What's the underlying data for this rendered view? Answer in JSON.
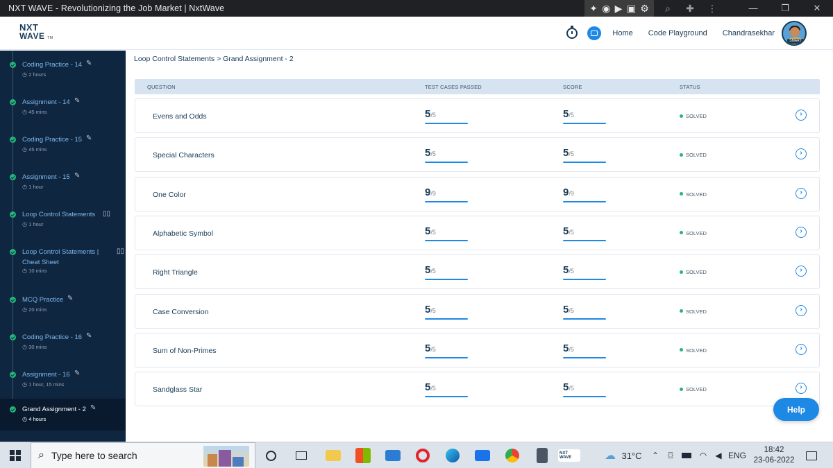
{
  "window": {
    "title": "NXT WAVE - Revolutionizing the Job Market | NxtWave"
  },
  "header": {
    "logo_line1": "NXT",
    "logo_line2": "WAVE",
    "logo_tm": "TM",
    "nav": [
      "Home",
      "Code Playground"
    ],
    "user_name": "Chandrasekhar",
    "avatar_badge": "SMART"
  },
  "sidebar": {
    "items": [
      {
        "name": "Coding Practice - 14",
        "duration": "2 hours",
        "icon": "pencil-icon"
      },
      {
        "name": "Assignment - 14",
        "duration": "45 mins",
        "icon": "pencil-icon"
      },
      {
        "name": "Coding Practice - 15",
        "duration": "45 mins",
        "icon": "pencil-icon"
      },
      {
        "name": "Assignment - 15",
        "duration": "1 hour",
        "icon": "pencil-icon"
      },
      {
        "name": "Loop Control Statements",
        "duration": "1 hour",
        "icon": "book-icon"
      },
      {
        "name": "Loop Control Statements | Cheat Sheet",
        "duration": "10 mins",
        "icon": "book-icon"
      },
      {
        "name": "MCQ Practice",
        "duration": "20 mins",
        "icon": "pencil-icon"
      },
      {
        "name": "Coding Practice - 16",
        "duration": "30 mins",
        "icon": "pencil-icon"
      },
      {
        "name": "Assignment - 16",
        "duration": "1 hour, 15 mins",
        "icon": "pencil-icon"
      },
      {
        "name": "Grand Assignment - 2",
        "duration": "4 hours",
        "icon": "pencil-icon",
        "active": true
      }
    ]
  },
  "main": {
    "breadcrumb": "Loop Control Statements > Grand Assignment - 2",
    "columns": {
      "question": "QUESTION",
      "tests": "TEST CASES PASSED",
      "score": "SCORE",
      "status": "STATUS"
    },
    "rows": [
      {
        "question": "Evens and Odds",
        "tests_passed": "5",
        "tests_total": "/5",
        "score": "5",
        "score_total": "/5",
        "status": "SOLVED"
      },
      {
        "question": "Special Characters",
        "tests_passed": "5",
        "tests_total": "/5",
        "score": "5",
        "score_total": "/5",
        "status": "SOLVED"
      },
      {
        "question": "One Color",
        "tests_passed": "9",
        "tests_total": "/9",
        "score": "9",
        "score_total": "/9",
        "status": "SOLVED"
      },
      {
        "question": "Alphabetic Symbol",
        "tests_passed": "5",
        "tests_total": "/5",
        "score": "5",
        "score_total": "/5",
        "status": "SOLVED"
      },
      {
        "question": "Right Triangle",
        "tests_passed": "5",
        "tests_total": "/5",
        "score": "5",
        "score_total": "/5",
        "status": "SOLVED"
      },
      {
        "question": "Case Conversion",
        "tests_passed": "5",
        "tests_total": "/5",
        "score": "5",
        "score_total": "/5",
        "status": "SOLVED"
      },
      {
        "question": "Sum of Non-Primes",
        "tests_passed": "5",
        "tests_total": "/5",
        "score": "5",
        "score_total": "/5",
        "status": "SOLVED"
      },
      {
        "question": "Sandglass Star",
        "tests_passed": "5",
        "tests_total": "/5",
        "score": "5",
        "score_total": "/5",
        "status": "SOLVED"
      }
    ],
    "progress_fraction": 1.0,
    "help_label": "Help"
  },
  "taskbar": {
    "search_placeholder": "Type here to search",
    "temperature": "31°C",
    "language": "ENG",
    "time": "18:42",
    "date": "23-06-2022",
    "pinned_app_label": "NXT WAVE"
  },
  "colors": {
    "sidebar_bg": "#0f2640",
    "accent": "#1e88e5",
    "solved": "#24b57a",
    "table_header": "#d6e3f1"
  }
}
